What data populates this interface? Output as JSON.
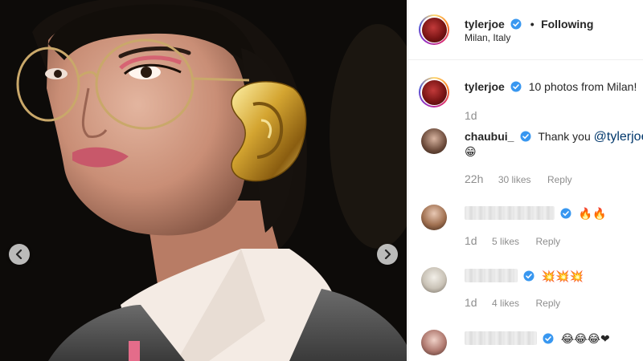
{
  "post": {
    "username": "tylerjoe",
    "separator": "•",
    "follow_status": "Following",
    "location": "Milan, Italy"
  },
  "caption": {
    "username": "tylerjoe",
    "text": "10 photos from Milan!",
    "time": "1d"
  },
  "comments": [
    {
      "username": "chaubui_",
      "text": "Thank you ",
      "mention": "@tylerjoe",
      "emoji": "😁",
      "time": "22h",
      "likes": "30 likes",
      "reply": "Reply"
    },
    {
      "username": "",
      "emoji": "🔥🔥",
      "time": "1d",
      "likes": "5 likes",
      "reply": "Reply"
    },
    {
      "username": "",
      "emoji": "💥💥💥",
      "time": "1d",
      "likes": "4 likes",
      "reply": "Reply"
    },
    {
      "username": "",
      "emoji": "😂😂😂❤",
      "time": "",
      "likes": "",
      "reply": ""
    }
  ],
  "icons": {
    "prev": "chevron-left-icon",
    "next": "chevron-right-icon",
    "verified": "verified-badge-icon"
  },
  "colors": {
    "verified_blue": "#3897f0",
    "mention_blue": "#00376b",
    "muted_text": "#8e8e8e"
  }
}
